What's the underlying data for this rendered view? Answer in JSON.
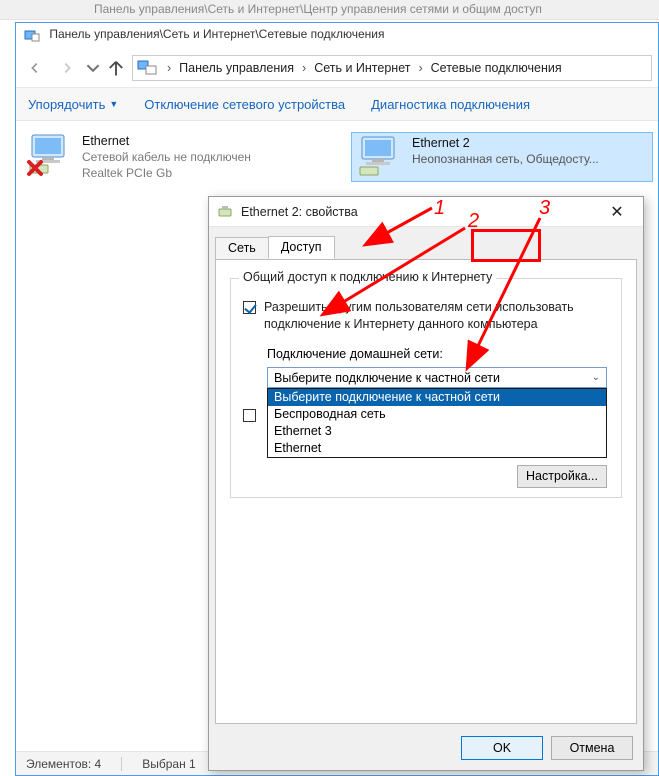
{
  "bg_window_title": "Панель управления\\Сеть и Интернет\\Центр управления сетями и общим доступ",
  "window_title": "Панель управления\\Сеть и Интернет\\Сетевые подключения",
  "breadcrumb": {
    "seg1": "Панель управления",
    "seg2": "Сеть и Интернет",
    "seg3": "Сетевые подключения"
  },
  "commands": {
    "arrange": "Упорядочить",
    "disable": "Отключение сетевого устройства",
    "diagnose": "Диагностика подключения"
  },
  "connections": [
    {
      "name": "Ethernet",
      "line2": "Сетевой кабель не подключен",
      "line3": "Realtek PCIe Gb"
    },
    {
      "name": "Ethernet 2",
      "line2": "Неопознанная сеть, Общедосту..."
    }
  ],
  "statusbar": {
    "count_label": "Элементов: 4",
    "selected_label": "Выбран 1"
  },
  "dialog": {
    "title": "Ethernet 2: свойства",
    "tab_net": "Сеть",
    "tab_share": "Доступ",
    "group_legend": "Общий доступ к подключению к Интернету",
    "chk1": "Разрешить другим пользователям сети использовать подключение к Интернету данного компьютера",
    "home_net_label": "Подключение домашней сети:",
    "dd_selected": "Выберите подключение к частной сети",
    "dd_options": [
      "Выберите подключение к частной сети",
      "Беспроводная сеть",
      "Ethernet 3",
      "Ethernet"
    ],
    "config_btn": "Настройка...",
    "ok": "OK",
    "cancel": "Отмена"
  },
  "annotations": {
    "n1": "1",
    "n2": "2",
    "n3": "3"
  }
}
